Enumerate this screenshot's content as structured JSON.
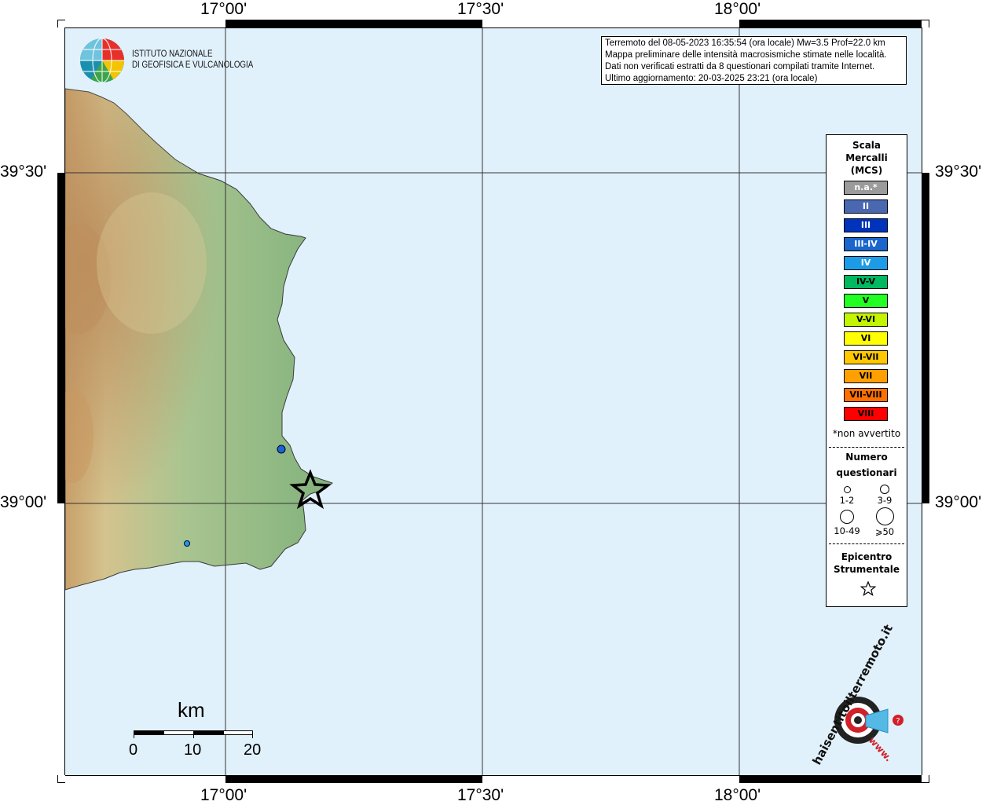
{
  "map": {
    "top_labels": [
      "17°00'",
      "17°30'",
      "18°00'"
    ],
    "bottom_labels": [
      "17°00'",
      "17°30'",
      "18°00'"
    ],
    "left_labels": [
      "39°30'",
      "39°00'"
    ],
    "right_labels": [
      "39°30'",
      "39°00'"
    ],
    "sea_color": "#e1f1fc",
    "land_color": "#8cb583"
  },
  "logo": {
    "line1": "ISTITUTO NAZIONALE",
    "line2": "DI GEOFISICA E VULCANOLOGIA"
  },
  "info": {
    "line1": "Terremoto del 08-05-2023 16:35:54 (ora locale) Mw=3.5 Prof=22.0 km",
    "line2": "Mappa preliminare delle intensità macrosismiche stimate nelle località.",
    "line3": "Dati non verificati estratti da 8 questionari compilati tramite Internet.",
    "line4": "Ultimo aggiornamento: 20-03-2025 23:21 (ora locale)"
  },
  "legend": {
    "title_line1": "Scala",
    "title_line2": "Mercalli",
    "title_line3": "(MCS)",
    "classes": [
      {
        "label": "n.a.*",
        "color": "#9b9b9b",
        "text": "#ffffff"
      },
      {
        "label": "II",
        "color": "#4a67b2",
        "text": "#ffffff"
      },
      {
        "label": "III",
        "color": "#0033bb",
        "text": "#ffffff"
      },
      {
        "label": "III-IV",
        "color": "#1a66cc",
        "text": "#ffffff"
      },
      {
        "label": "IV",
        "color": "#1c9ce6",
        "text": "#ffffff"
      },
      {
        "label": "IV-V",
        "color": "#00b860",
        "text": "#000000"
      },
      {
        "label": "V",
        "color": "#22ff22",
        "text": "#000000"
      },
      {
        "label": "V-VI",
        "color": "#c4f500",
        "text": "#000000"
      },
      {
        "label": "VI",
        "color": "#ffff00",
        "text": "#000000"
      },
      {
        "label": "VI-VII",
        "color": "#ffc800",
        "text": "#000000"
      },
      {
        "label": "VII",
        "color": "#ffa000",
        "text": "#000000"
      },
      {
        "label": "VII-VIII",
        "color": "#ff7000",
        "text": "#000000"
      },
      {
        "label": "VIII",
        "color": "#ff0000",
        "text": "#000000"
      }
    ],
    "note": "*non avvertito",
    "questionnaires_title1": "Numero",
    "questionnaires_title2": "questionari",
    "q_labels": [
      "1-2",
      "3-9",
      "10-49",
      "⩾50"
    ],
    "epicenter_title1": "Epicentro",
    "epicenter_title2": "Strumentale"
  },
  "scalebar": {
    "unit": "km",
    "labels": [
      "0",
      "10",
      "20"
    ]
  },
  "markers": [
    {
      "name": "marker-iii-iv",
      "color": "#1a66cc"
    },
    {
      "name": "marker-iv",
      "color": "#1c9ce6"
    }
  ],
  "watermark": {
    "text": "haisentitoilterremoto.it",
    "url": "www."
  }
}
